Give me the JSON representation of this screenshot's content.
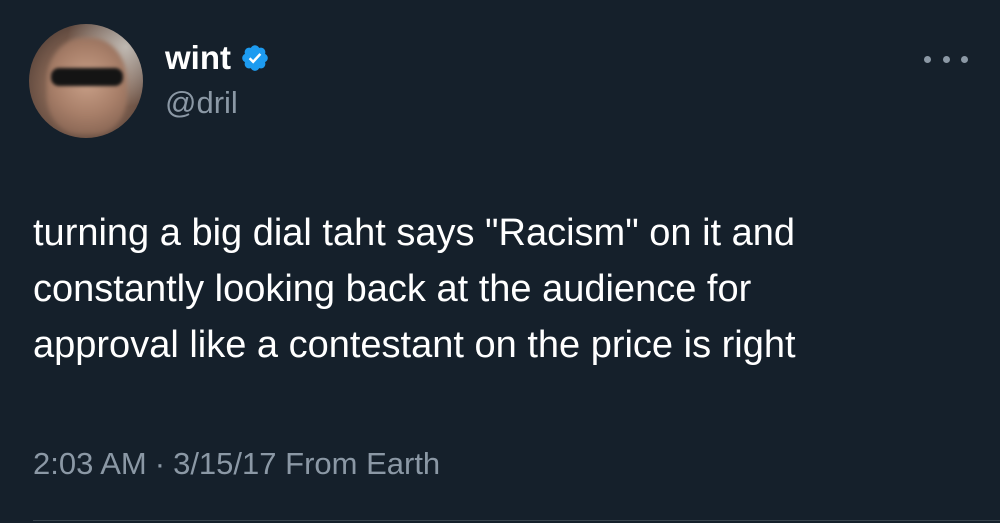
{
  "author": {
    "display_name": "wint",
    "handle": "@dril",
    "verified_icon": "verified-badge",
    "verified_color": "#1d9bf0",
    "avatar": "profile-photo"
  },
  "tweet": {
    "lines": [
      "turning a big dial taht says \"Racism\" on it and",
      "constantly looking back at the audience for",
      "approval like a contestant on the price is right"
    ]
  },
  "meta": {
    "time": "2:03 AM",
    "separator": "·",
    "date": "3/15/17",
    "source": "From Earth"
  },
  "icons": {
    "more": "more-options-icon"
  },
  "colors": {
    "background": "#15202b",
    "text_primary": "#ffffff",
    "text_secondary": "#8b98a5",
    "divider": "#38444d"
  }
}
